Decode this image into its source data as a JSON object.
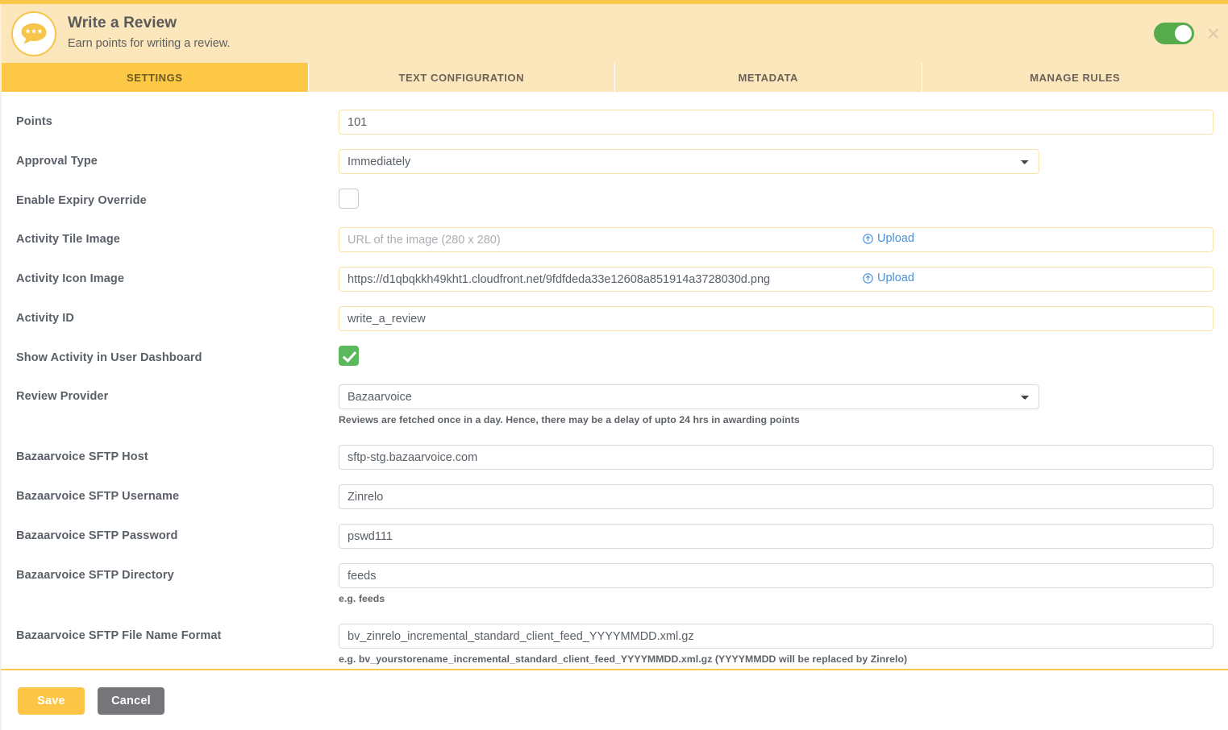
{
  "header": {
    "title": "Write a Review",
    "subtitle": "Earn points for writing a review.",
    "icon": "review-speech-bubble-icon",
    "toggle_state": "on",
    "close_label": "×",
    "accent_color": "#fac74b",
    "toggle_color": "#56ab4a"
  },
  "tabs": [
    {
      "label": "SETTINGS",
      "active": true
    },
    {
      "label": "TEXT CONFIGURATION",
      "active": false
    },
    {
      "label": "METADATA",
      "active": false
    },
    {
      "label": "MANAGE RULES",
      "active": false
    }
  ],
  "form": {
    "points": {
      "label": "Points",
      "value": "101"
    },
    "approval_type": {
      "label": "Approval Type",
      "value": "Immediately",
      "options": [
        "Immediately"
      ]
    },
    "enable_expiry_override": {
      "label": "Enable Expiry Override",
      "checked": false
    },
    "activity_tile_image": {
      "label": "Activity Tile Image",
      "value": "",
      "placeholder": "URL of the image (280 x 280)",
      "upload_label": "Upload"
    },
    "activity_icon_image": {
      "label": "Activity Icon Image",
      "value": "https://d1qbqkkh49kht1.cloudfront.net/9fdfdeda33e12608a851914a3728030d.png",
      "upload_label": "Upload"
    },
    "activity_id": {
      "label": "Activity ID",
      "value": "write_a_review",
      "disabled": true
    },
    "show_activity_in_user_dashboard": {
      "label": "Show Activity in User Dashboard",
      "checked": true
    },
    "review_provider": {
      "label": "Review Provider",
      "value": "Bazaarvoice",
      "options": [
        "Bazaarvoice"
      ],
      "hint": "Reviews are fetched once in a day. Hence, there may be a delay of upto 24 hrs in awarding points"
    },
    "sftp_host": {
      "label": "Bazaarvoice SFTP Host",
      "value": "sftp-stg.bazaarvoice.com"
    },
    "sftp_username": {
      "label": "Bazaarvoice SFTP Username",
      "value": "Zinrelo"
    },
    "sftp_password": {
      "label": "Bazaarvoice SFTP Password",
      "value": "pswd111"
    },
    "sftp_directory": {
      "label": "Bazaarvoice SFTP Directory",
      "value": "feeds",
      "hint": "e.g. feeds"
    },
    "sftp_file_name_format": {
      "label": "Bazaarvoice SFTP File Name Format",
      "value": "bv_zinrelo_incremental_standard_client_feed_YYYYMMDD.xml.gz",
      "hint": "e.g. bv_yourstorename_incremental_standard_client_feed_YYYYMMDD.xml.gz (YYYYMMDD will be replaced by Zinrelo)"
    }
  },
  "footer": {
    "save_label": "Save",
    "cancel_label": "Cancel"
  }
}
